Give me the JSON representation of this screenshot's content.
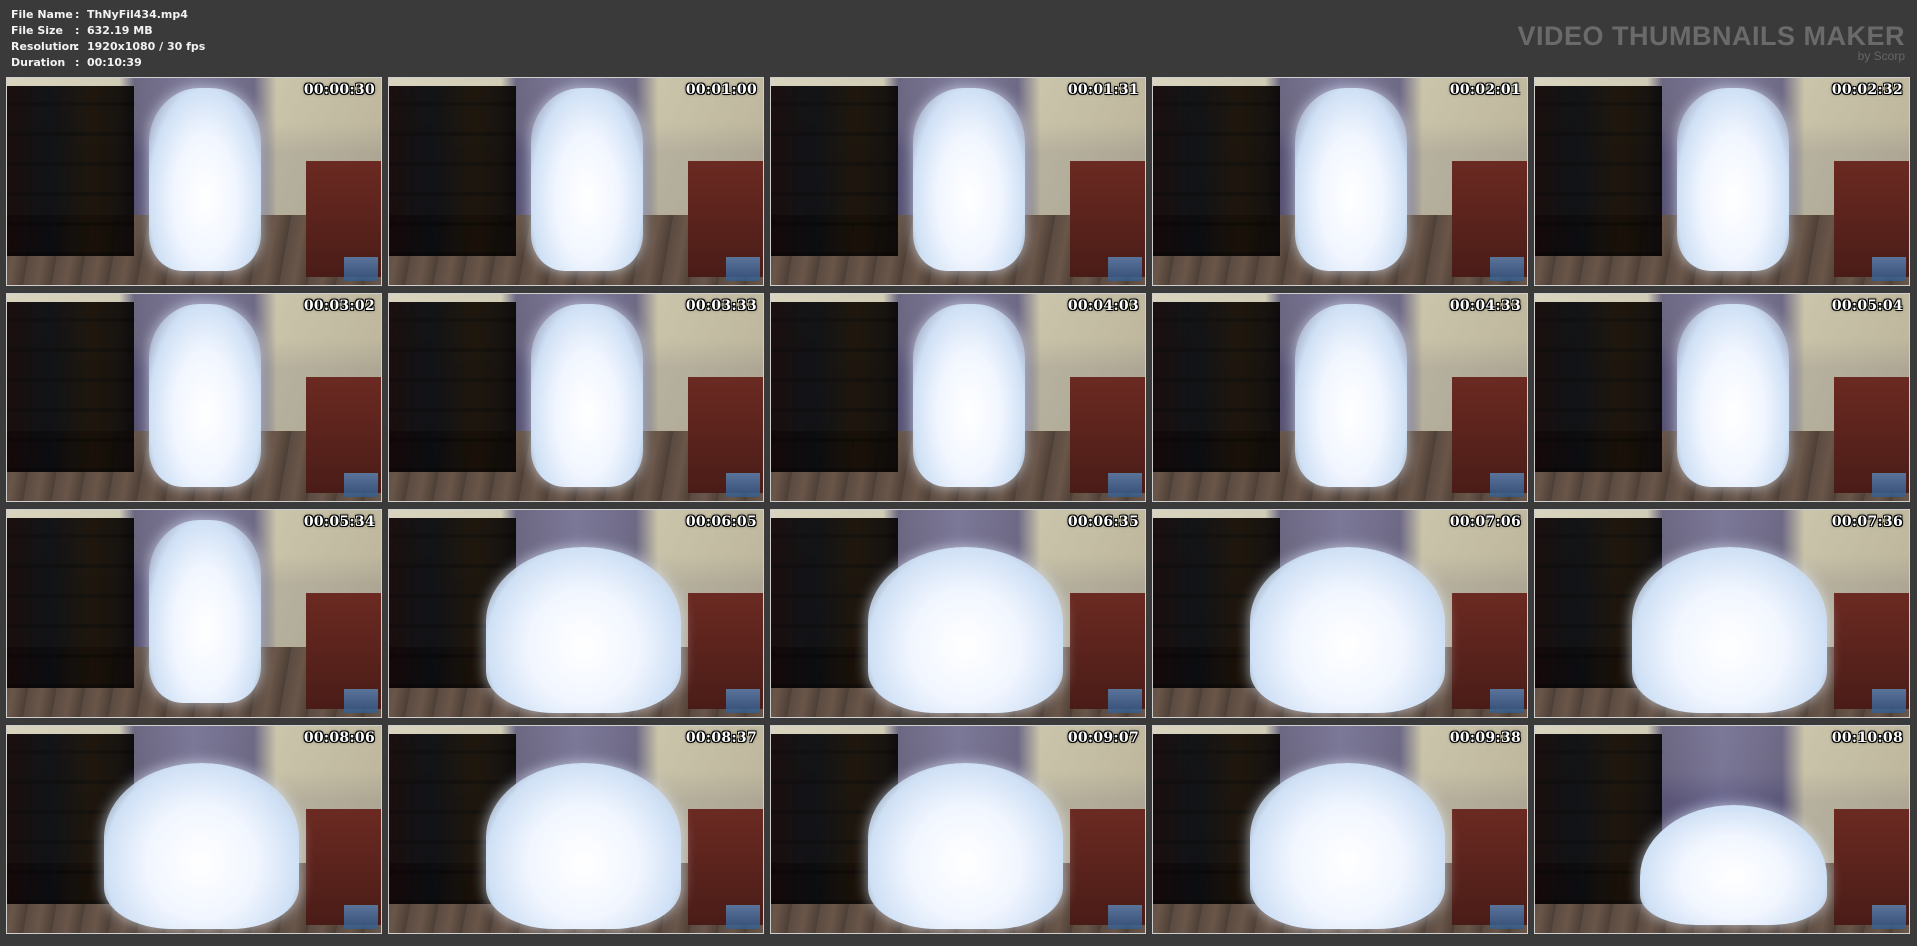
{
  "header": {
    "info": [
      {
        "label": "File Name",
        "sep": ":",
        "value": "ThNyFil434.mp4"
      },
      {
        "label": "File Size",
        "sep": ":",
        "value": "632.19 MB"
      },
      {
        "label": "Resolution",
        "sep": ":",
        "value": "1920x1080 / 30 fps"
      },
      {
        "label": "Duration",
        "sep": ":",
        "value": "00:10:39"
      }
    ],
    "brand_title": "VIDEO THUMBNAILS MAKER",
    "brand_sub": "by Scorp"
  },
  "thumbnails": [
    {
      "time": "00:00:30",
      "pose": "standing"
    },
    {
      "time": "00:01:00",
      "pose": "standing"
    },
    {
      "time": "00:01:31",
      "pose": "standing"
    },
    {
      "time": "00:02:01",
      "pose": "standing"
    },
    {
      "time": "00:02:32",
      "pose": "standing"
    },
    {
      "time": "00:03:02",
      "pose": "standing"
    },
    {
      "time": "00:03:33",
      "pose": "standing"
    },
    {
      "time": "00:04:03",
      "pose": "standing"
    },
    {
      "time": "00:04:33",
      "pose": "standing"
    },
    {
      "time": "00:05:04",
      "pose": "standing"
    },
    {
      "time": "00:05:34",
      "pose": "standing"
    },
    {
      "time": "00:06:05",
      "pose": "kneeling"
    },
    {
      "time": "00:06:35",
      "pose": "kneeling"
    },
    {
      "time": "00:07:06",
      "pose": "kneeling"
    },
    {
      "time": "00:07:36",
      "pose": "kneeling"
    },
    {
      "time": "00:08:06",
      "pose": "kneeling"
    },
    {
      "time": "00:08:37",
      "pose": "kneeling"
    },
    {
      "time": "00:09:07",
      "pose": "kneeling"
    },
    {
      "time": "00:09:38",
      "pose": "kneeling"
    },
    {
      "time": "00:10:08",
      "pose": "crouched"
    }
  ],
  "colors": {
    "background": "#3a3a3a",
    "header_text": "#f2f2f2",
    "brand_text": "#6a6a6a",
    "thumb_border": "#cfcfcf",
    "timestamp_text": "#ffffff"
  },
  "icons": {
    "watermark": "studio-logo-icon"
  }
}
